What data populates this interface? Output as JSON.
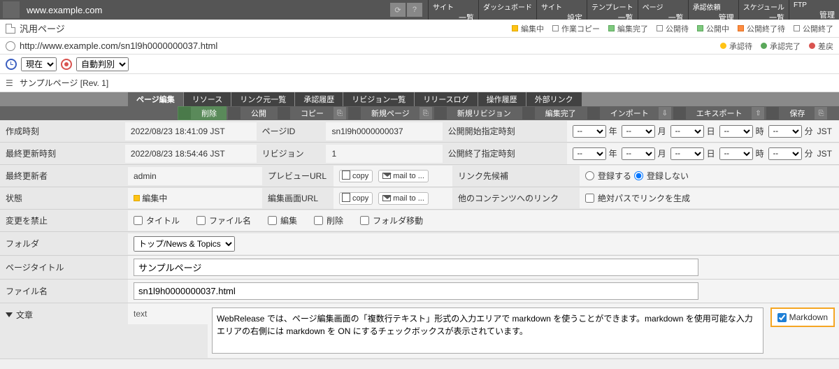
{
  "url_display": "www.example.com",
  "top_tabs": [
    {
      "hi": "サイト",
      "lo": "一覧"
    },
    {
      "hi": "ダッシュボード",
      "lo": ""
    },
    {
      "hi": "サイト",
      "lo": "設定"
    },
    {
      "hi": "テンプレート",
      "lo": "一覧"
    },
    {
      "hi": "ページ",
      "lo": "一覧"
    },
    {
      "hi": "承認依頼",
      "lo": "管理"
    },
    {
      "hi": "スケジュール",
      "lo": "一覧"
    },
    {
      "hi": "FTP",
      "lo": "管理"
    }
  ],
  "page_type": "汎用ページ",
  "full_url": "http://www.example.com/sn1l9h0000000037.html",
  "legend1": [
    {
      "cls": "sq-y",
      "t": "編集中"
    },
    {
      "cls": "sq-hol",
      "t": "作業コピー"
    },
    {
      "cls": "sq-g",
      "t": "編集完了"
    },
    {
      "cls": "sq-hol",
      "t": "公開待"
    },
    {
      "cls": "sq-g",
      "t": "公開中"
    },
    {
      "cls": "sq-o",
      "t": "公開終了待"
    },
    {
      "cls": "sq-hol",
      "t": "公開終了"
    }
  ],
  "legend2": [
    {
      "cls": "dot-y",
      "t": "承認待"
    },
    {
      "cls": "dot-g",
      "t": "承認完了"
    },
    {
      "cls": "dot-r",
      "t": "差戻"
    }
  ],
  "time_sel": "現在",
  "auto_sel": "自動判別",
  "rev_title": "サンプルページ [Rev. 1]",
  "tabs": [
    "ページ編集",
    "リソース",
    "リンク元一覧",
    "承認履歴",
    "リビジョン一覧",
    "リリースログ",
    "操作履歴",
    "外部リンク"
  ],
  "toolbar": [
    {
      "t": "削除",
      "cls": "del"
    },
    {
      "t": "公開"
    },
    {
      "t": "コピー",
      "ic": "⎘"
    },
    {
      "t": "新規ページ",
      "ic": "⎘"
    },
    {
      "t": "新規リビジョン"
    },
    {
      "t": "編集完了"
    },
    {
      "t": "インポート",
      "ic": "⇩"
    },
    {
      "t": "エキスポート",
      "ic": "⇧"
    },
    {
      "t": "保存",
      "ic": "⎘"
    }
  ],
  "meta": {
    "created_l": "作成時刻",
    "created_v": "2022/08/23 18:41:09 JST",
    "pageid_l": "ページID",
    "pageid_v": "sn1l9h0000000037",
    "pubstart_l": "公開開始指定時刻",
    "updated_l": "最終更新時刻",
    "updated_v": "2022/08/23 18:54:46 JST",
    "rev_l": "リビジョン",
    "rev_v": "1",
    "pubend_l": "公開終了指定時刻",
    "updater_l": "最終更新者",
    "updater_v": "admin",
    "preview_l": "プレビューURL",
    "copy": "copy",
    "mailto": "mail to ...",
    "linkcand_l": "リンク先候補",
    "reg_yes": "登録する",
    "reg_no": "登録しない",
    "state_l": "状態",
    "state_v": "編集中",
    "editurl_l": "編集画面URL",
    "otherlink_l": "他のコンテンツへのリンク",
    "abs_l": "絶対パスでリンクを生成",
    "forbid_l": "変更を禁止",
    "forbid_opts": [
      "タイトル",
      "ファイル名",
      "編集",
      "削除",
      "フォルダ移動"
    ]
  },
  "date_units": [
    "年",
    "月",
    "日",
    "時",
    "分",
    "JST"
  ],
  "date_opt": "--",
  "folder_l": "フォルダ",
  "folder_v": "トップ/News & Topics",
  "title_l": "ページタイトル",
  "title_v": "サンプルページ",
  "file_l": "ファイル名",
  "file_v": "sn1l9h0000000037.html",
  "content_l": "文章",
  "content_type": "text",
  "content_v": "WebRelease では、ページ編集画面の「複数行テキスト」形式の入力エリアで markdown を使うことができます。markdown を使用可能な入力エリアの右側には markdown を ON にするチェックボックスが表示されています。",
  "markdown_l": "Markdown"
}
